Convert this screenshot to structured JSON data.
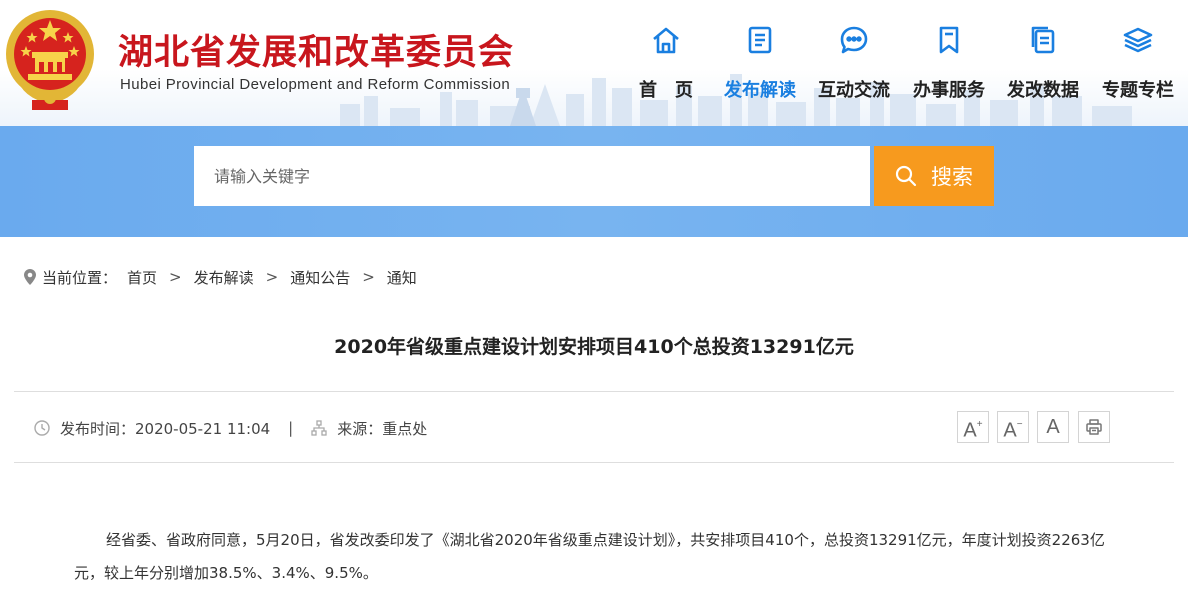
{
  "header": {
    "title": "湖北省发展和改革委员会",
    "subtitle": "Hubei Provincial Development and Reform Commission"
  },
  "nav": [
    {
      "label": "首　页",
      "icon": "home-icon"
    },
    {
      "label": "发布解读",
      "icon": "document-icon",
      "active": true
    },
    {
      "label": "互动交流",
      "icon": "chat-bubble-icon"
    },
    {
      "label": "办事服务",
      "icon": "bookmark-icon"
    },
    {
      "label": "发改数据",
      "icon": "copy-docs-icon"
    },
    {
      "label": "专题专栏",
      "icon": "layers-icon"
    }
  ],
  "colors": {
    "brand_red": "#c8161d",
    "accent_blue": "#1a7fe0",
    "search_band": "#78b4f0",
    "search_button": "#f79a1e"
  },
  "search": {
    "placeholder": "请输入关键字",
    "button_label": "搜索"
  },
  "breadcrumb": {
    "prefix": "当前位置：",
    "items": [
      "首页",
      "发布解读",
      "通知公告",
      "通知"
    ],
    "separator": ">"
  },
  "article": {
    "title": "2020年省级重点建设计划安排项目410个总投资13291亿元",
    "publish": "发布时间：2020-05-21 11:04",
    "divider": "|",
    "source": "来源：重点处",
    "paragraph": "经省委、省政府同意，5月20日，省发改委印发了《湖北省2020年省级重点建设计划》，共安排项目410个，总投资13291亿元，年度计划投资2263亿元，较上年分别增加38.5%、3.4%、9.5%。"
  },
  "tools": {
    "font_larger": "A",
    "font_smaller": "A",
    "font_normal": "A",
    "plus": "+",
    "minus": "−"
  }
}
